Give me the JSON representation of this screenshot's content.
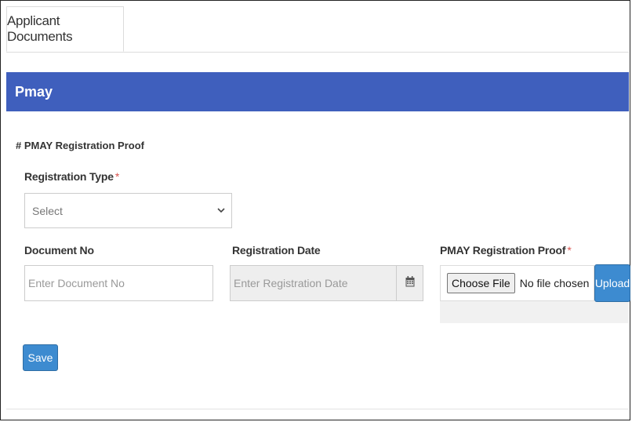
{
  "tabs": [
    {
      "label": "Applicant Documents"
    }
  ],
  "panel": {
    "title": "Pmay"
  },
  "section": {
    "title": "# PMAY Registration Proof"
  },
  "form": {
    "registration_type": {
      "label": "Registration Type",
      "required": "*",
      "selected": "Select"
    },
    "document_no": {
      "label": "Document No",
      "placeholder": "Enter Document No"
    },
    "registration_date": {
      "label": "Registration Date",
      "placeholder": "Enter Registration Date",
      "icon": "calendar-icon"
    },
    "proof": {
      "label": "PMAY Registration Proof",
      "required": "*",
      "choose_label": "Choose File",
      "status": "No file chosen",
      "upload_label": "Upload"
    },
    "save_label": "Save"
  },
  "colors": {
    "header": "#3f5fbd",
    "button": "#3d8bd0",
    "required": "#d9534f"
  }
}
